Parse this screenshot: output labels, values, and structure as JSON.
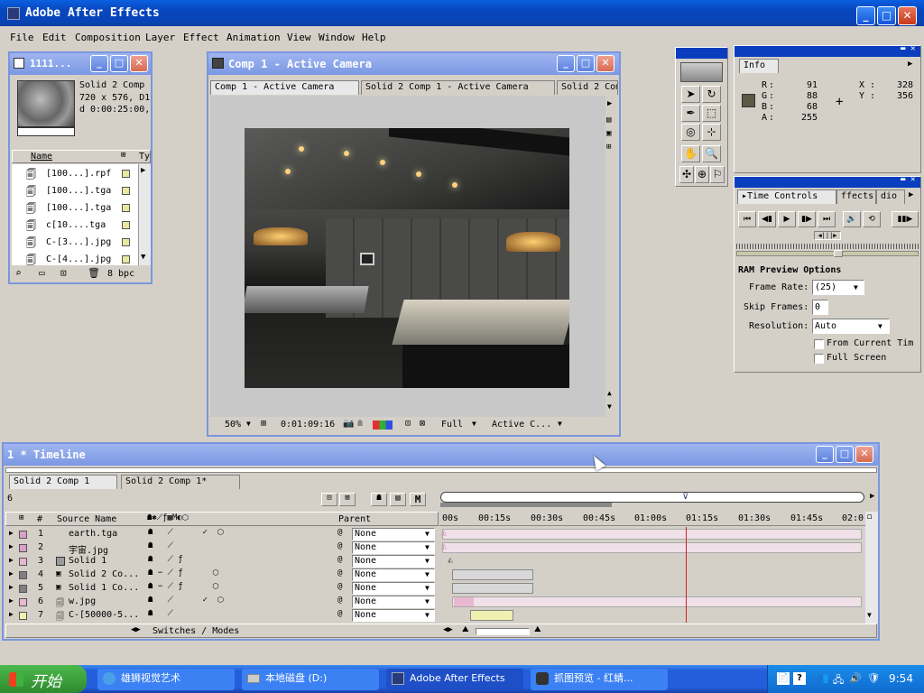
{
  "app": {
    "title": "Adobe After Effects"
  },
  "menu": [
    "File",
    "Edit",
    "Composition",
    "Layer",
    "Effect",
    "Animation",
    "View",
    "Window",
    "Help"
  ],
  "project": {
    "title": "1111...",
    "info": [
      "Solid 2 Comp",
      "720 x 576, D1",
      "d 0:00:25:00,"
    ],
    "col_name": "Name",
    "col_type": "Ty",
    "items": [
      "[100...].rpf",
      "[100...].tga",
      "[100...].tga",
      "c[10....tga",
      "C-[3...].jpg",
      "C-[4...].jpg"
    ],
    "bpc": "8 bpc"
  },
  "comp": {
    "title": "Comp 1 - Active Camera",
    "tabs": [
      "Comp 1 - Active Camera",
      "Solid 2 Comp 1 - Active Camera",
      "Solid 2 Com"
    ],
    "zoom": "50%",
    "timecode": "0:01:09:16",
    "resolution": "Full",
    "camera": "Active C..."
  },
  "info": {
    "tab": "Info",
    "R": "91",
    "G": "88",
    "B": "68",
    "A": "255",
    "X": "328",
    "Y": "356",
    "color": "#5b5844"
  },
  "time_controls": {
    "tab1": "Time Controls",
    "tab2": "ffects",
    "tab3": "dio",
    "ram_title": "RAM Preview Options",
    "frame_rate_label": "Frame Rate:",
    "frame_rate_value": "(25)",
    "skip_frames_label": "Skip Frames:",
    "skip_frames_value": "0",
    "resolution_label": "Resolution:",
    "resolution_value": "Auto",
    "from_current": "From Current Tim",
    "full_screen": "Full Screen"
  },
  "timeline": {
    "title": "1 * Timeline",
    "tabs": [
      "Solid 2 Comp 1",
      "Solid 2 Comp 1*"
    ],
    "col_source": "Source Name",
    "col_parent": "Parent",
    "col_num": "#",
    "switches": "Switches / Modes",
    "ruler": [
      "00s",
      "00:15s",
      "00:30s",
      "00:45s",
      "01:00s",
      "01:15s",
      "01:30s",
      "01:45s",
      "02:0"
    ],
    "layers": [
      {
        "num": "1",
        "name": "earth.tga",
        "parent": "None",
        "color": "#d8a0c8"
      },
      {
        "num": "2",
        "name": "宇宙.jpg",
        "parent": "None",
        "color": "#d8a0c8"
      },
      {
        "num": "3",
        "name": "Solid 1",
        "parent": "None",
        "color": "#e8b8d0"
      },
      {
        "num": "4",
        "name": "Solid 2 Co...",
        "parent": "None",
        "color": "#808080"
      },
      {
        "num": "5",
        "name": "Solid 1 Co...",
        "parent": "None",
        "color": "#808080"
      },
      {
        "num": "6",
        "name": "w.jpg",
        "parent": "None",
        "color": "#e8b8d0"
      },
      {
        "num": "7",
        "name": "C-[50000-5...",
        "parent": "None",
        "color": "#f0f0b0"
      }
    ],
    "mode_label": "M",
    "frame_digit": "6"
  },
  "taskbar": {
    "start": "开始",
    "items": [
      "雄狮视觉艺术",
      "本地磁盘 (D:)",
      "Adobe After Effects",
      "抓图预览 - 红蜻..."
    ],
    "time": "9:54"
  }
}
